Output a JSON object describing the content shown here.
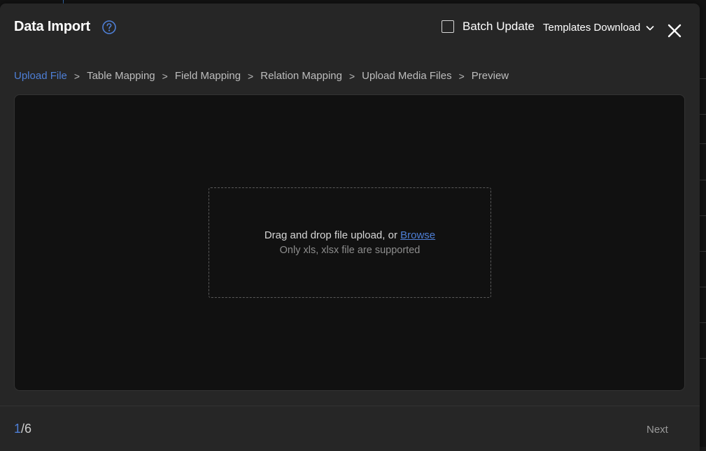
{
  "dialog": {
    "title": "Data Import",
    "batch_update_label": "Batch Update",
    "batch_update_checked": false,
    "templates_download_label": "Templates Download"
  },
  "steps": [
    {
      "label": "Upload File",
      "active": true
    },
    {
      "label": "Table Mapping",
      "active": false
    },
    {
      "label": "Field Mapping",
      "active": false
    },
    {
      "label": "Relation Mapping",
      "active": false
    },
    {
      "label": "Upload Media Files",
      "active": false
    },
    {
      "label": "Preview",
      "active": false
    }
  ],
  "step_separator": ">",
  "dropzone": {
    "text": "Drag and drop file upload, or ",
    "browse_label": "Browse",
    "hint": "Only xls, xlsx file are supported"
  },
  "footer": {
    "current_page": "1",
    "separator": "/",
    "total_pages": "6",
    "next_label": "Next"
  },
  "colors": {
    "accent": "#4e7fd6",
    "background": "#262626",
    "panel": "#111111"
  }
}
